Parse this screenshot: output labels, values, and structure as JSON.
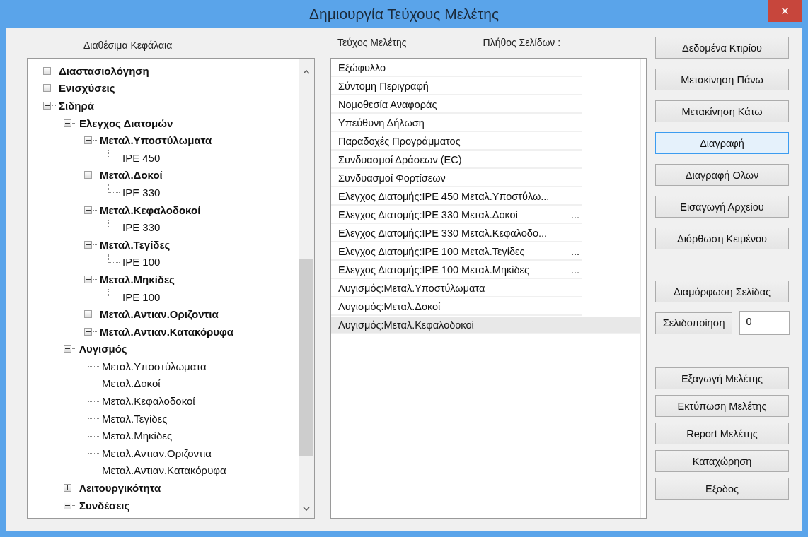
{
  "window": {
    "title": "Δημιουργία Τεύχους Μελέτης",
    "close": "✕"
  },
  "tree": {
    "heading": "Διαθέσιμα Κεφάλαια",
    "items": [
      {
        "label": "Διαστασιολόγηση",
        "expanded": false
      },
      {
        "label": "Ενισχύσεις",
        "expanded": false
      },
      {
        "label": "Σιδηρά",
        "expanded": true,
        "children": [
          {
            "label": "Ελεγχος Διατομών",
            "expanded": true,
            "children": [
              {
                "label": "Μεταλ.Υποστύλωματα",
                "expanded": true,
                "children": [
                  {
                    "label": "IPE 450"
                  }
                ]
              },
              {
                "label": "Μεταλ.Δοκοί",
                "expanded": true,
                "children": [
                  {
                    "label": "IPE 330"
                  }
                ]
              },
              {
                "label": "Μεταλ.Κεφαλοδοκοί",
                "expanded": true,
                "children": [
                  {
                    "label": "IPE 330"
                  }
                ]
              },
              {
                "label": "Μεταλ.Τεγίδες",
                "expanded": true,
                "children": [
                  {
                    "label": "IPE 100"
                  }
                ]
              },
              {
                "label": "Μεταλ.Μηκίδες",
                "expanded": true,
                "children": [
                  {
                    "label": "IPE 100"
                  }
                ]
              },
              {
                "label": "Μεταλ.Αντιαν.Οριζοντια",
                "expanded": false
              },
              {
                "label": "Μεταλ.Αντιαν.Κατακόρυφα",
                "expanded": false
              }
            ]
          },
          {
            "label": "Λυγισμός",
            "expanded": true,
            "children": [
              {
                "label": "Μεταλ.Υποστύλωματα"
              },
              {
                "label": "Μεταλ.Δοκοί"
              },
              {
                "label": "Μεταλ.Κεφαλοδοκοί"
              },
              {
                "label": "Μεταλ.Τεγίδες"
              },
              {
                "label": "Μεταλ.Μηκίδες"
              },
              {
                "label": "Μεταλ.Αντιαν.Οριζοντια"
              },
              {
                "label": "Μεταλ.Αντιαν.Κατακόρυφα"
              }
            ]
          },
          {
            "label": "Λειτουργικότητα",
            "expanded": false
          },
          {
            "label": "Συνδέσεις",
            "expanded": true
          }
        ]
      }
    ]
  },
  "list": {
    "heading": "Τεύχος Μελέτης",
    "pages_label": "Πλήθος Σελίδων :",
    "rows": [
      {
        "text": "Εξώφυλλο",
        "selected": false
      },
      {
        "text": "Σύντομη Περιγραφή",
        "selected": false
      },
      {
        "text": "Νομοθεσία Αναφοράς",
        "selected": false
      },
      {
        "text": "Υπεύθυνη Δήλωση",
        "selected": false
      },
      {
        "text": "Παραδοχές Προγράμματος",
        "selected": false
      },
      {
        "text": "Συνδυασμοί Δράσεων (EC)",
        "selected": false
      },
      {
        "text": "Συνδυασμοί Φορτίσεων",
        "selected": false
      },
      {
        "text": "Ελεγχος Διατομής:IPE 450 Μεταλ.Υποστύλω...",
        "selected": false
      },
      {
        "text": "Ελεγχος Διατομής:IPE 330 Μεταλ.Δοκοί",
        "ellipsis": "...",
        "selected": false
      },
      {
        "text": "Ελεγχος Διατομής:IPE 330 Μεταλ.Κεφαλοδο...",
        "selected": false
      },
      {
        "text": "Ελεγχος Διατομής:IPE 100 Μεταλ.Τεγίδες",
        "ellipsis": "...",
        "selected": false
      },
      {
        "text": "Ελεγχος Διατομής:IPE 100 Μεταλ.Μηκίδες",
        "ellipsis": "...",
        "selected": false
      },
      {
        "text": "Λυγισμός:Μεταλ.Υποστύλωματα",
        "selected": false
      },
      {
        "text": "Λυγισμός:Μεταλ.Δοκοί",
        "selected": false
      },
      {
        "text": "Λυγισμός:Μεταλ.Κεφαλοδοκοί",
        "selected": true
      }
    ]
  },
  "button_groups": [
    [
      {
        "label": "Δεδομένα Κτιρίου",
        "focused": false
      },
      {
        "label": "Μετακίνηση Πάνω",
        "focused": false
      },
      {
        "label": "Μετακίνηση Κάτω",
        "focused": false
      },
      {
        "label": "Διαγραφή",
        "focused": true
      },
      {
        "label": "Διαγραφή Ολων",
        "focused": false
      },
      {
        "label": "Εισαγωγή Αρχείου",
        "focused": false
      },
      {
        "label": "Διόρθωση Κειμένου",
        "focused": false
      }
    ],
    [
      {
        "label": "Διαμόρφωση Σελίδας",
        "focused": false
      },
      {
        "label": "Σελιδοποίηση",
        "focused": false,
        "field_value": "0"
      }
    ],
    [
      {
        "label": "Εξαγωγή Μελέτης",
        "focused": false
      },
      {
        "label": "Εκτύπωση Μελέτης",
        "focused": false
      },
      {
        "label": "Report Μελέτης",
        "focused": false
      },
      {
        "label": "Καταχώρηση",
        "focused": false
      },
      {
        "label": "Εξοδος",
        "focused": false
      }
    ]
  ]
}
